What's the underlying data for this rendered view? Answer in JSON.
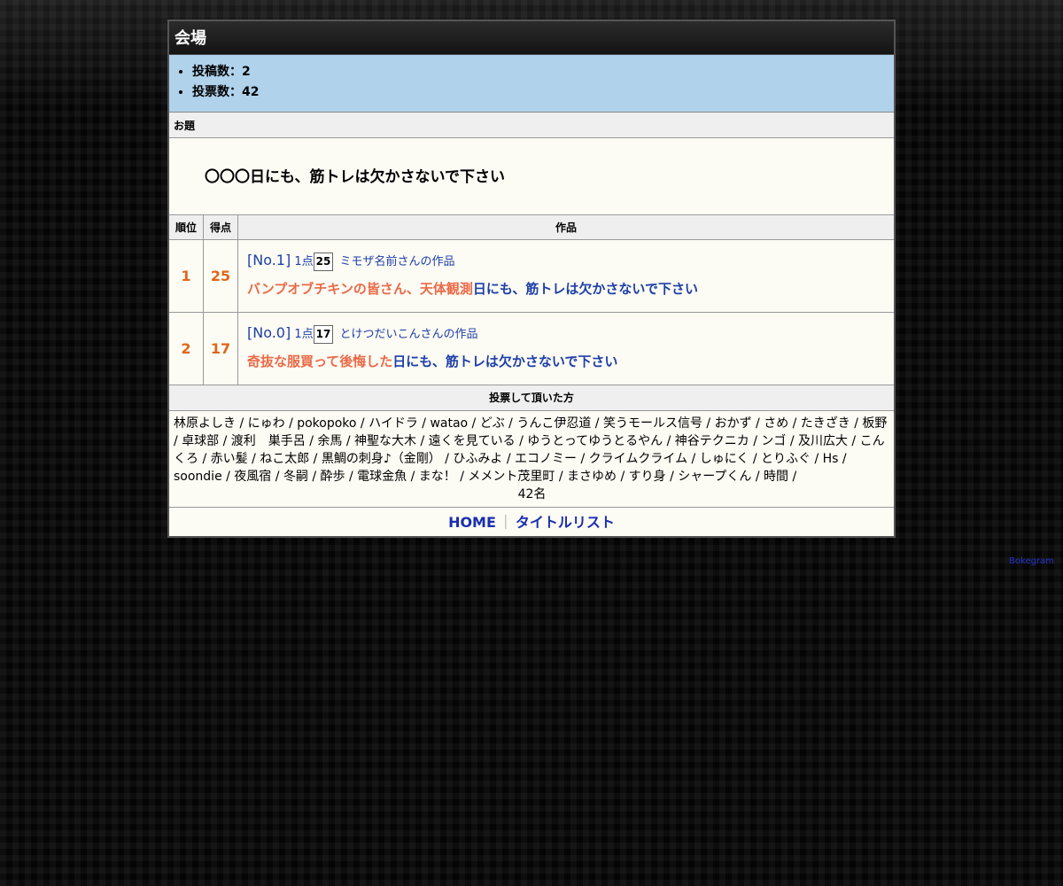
{
  "header": {
    "title": "会場"
  },
  "stats": {
    "posts": "投稿数：2",
    "votes": "投票数：42"
  },
  "odai": {
    "heading": "お題",
    "text": "〇〇〇日にも、筋トレは欠かさないで下さい"
  },
  "ranking": {
    "columns": [
      "順位",
      "得点",
      "作品"
    ],
    "rows": [
      {
        "rank": "1",
        "score": "25",
        "no": "[No.1]",
        "points_label": "1点",
        "points": "25",
        "author": "ミモザ名前さんの作品",
        "answer": "バンプオブチキンの皆さん、天体観測",
        "odai_part": "日にも、筋トレは欠かさないで下さい"
      },
      {
        "rank": "2",
        "score": "17",
        "no": "[No.0]",
        "points_label": "1点",
        "points": "17",
        "author": "とけつだいこんさんの作品",
        "answer": "奇抜な服買って後悔した",
        "odai_part": "日にも、筋トレは欠かさないで下さい"
      }
    ]
  },
  "voters": {
    "heading": "投票して頂いた方",
    "list": "林原よしき / にゅわ / pokopoko / ハイドラ / watao / どぶ / うんこ伊忍道 / 笑うモールス信号 / おかず / さめ / たきざき / 板野 / 卓球部 / 渡利　巣手呂 / 余馬 / 神聖な大木 / 遠くを見ている / ゆうとってゆうとるやん / 神谷テクニカ / ンゴ / 及川広大 / こんくろ / 赤い髪 / ねこ太郎 / 黒鯛の刺身♪（金剛） / ひふみよ / エコノミー / クライムクライム / しゅにく / とりふぐ / Hs / soondie / 夜風宿 / 冬嗣 / 酔歩 / 電球金魚 / まな！ / メメント茂里町 / まさゆめ / すり身 / シャープくん / 時間 /",
    "count": "42名"
  },
  "footer": {
    "home": "HOME",
    "separator": "｜",
    "title_list": "タイトルリスト"
  },
  "credit": "Bokegram"
}
